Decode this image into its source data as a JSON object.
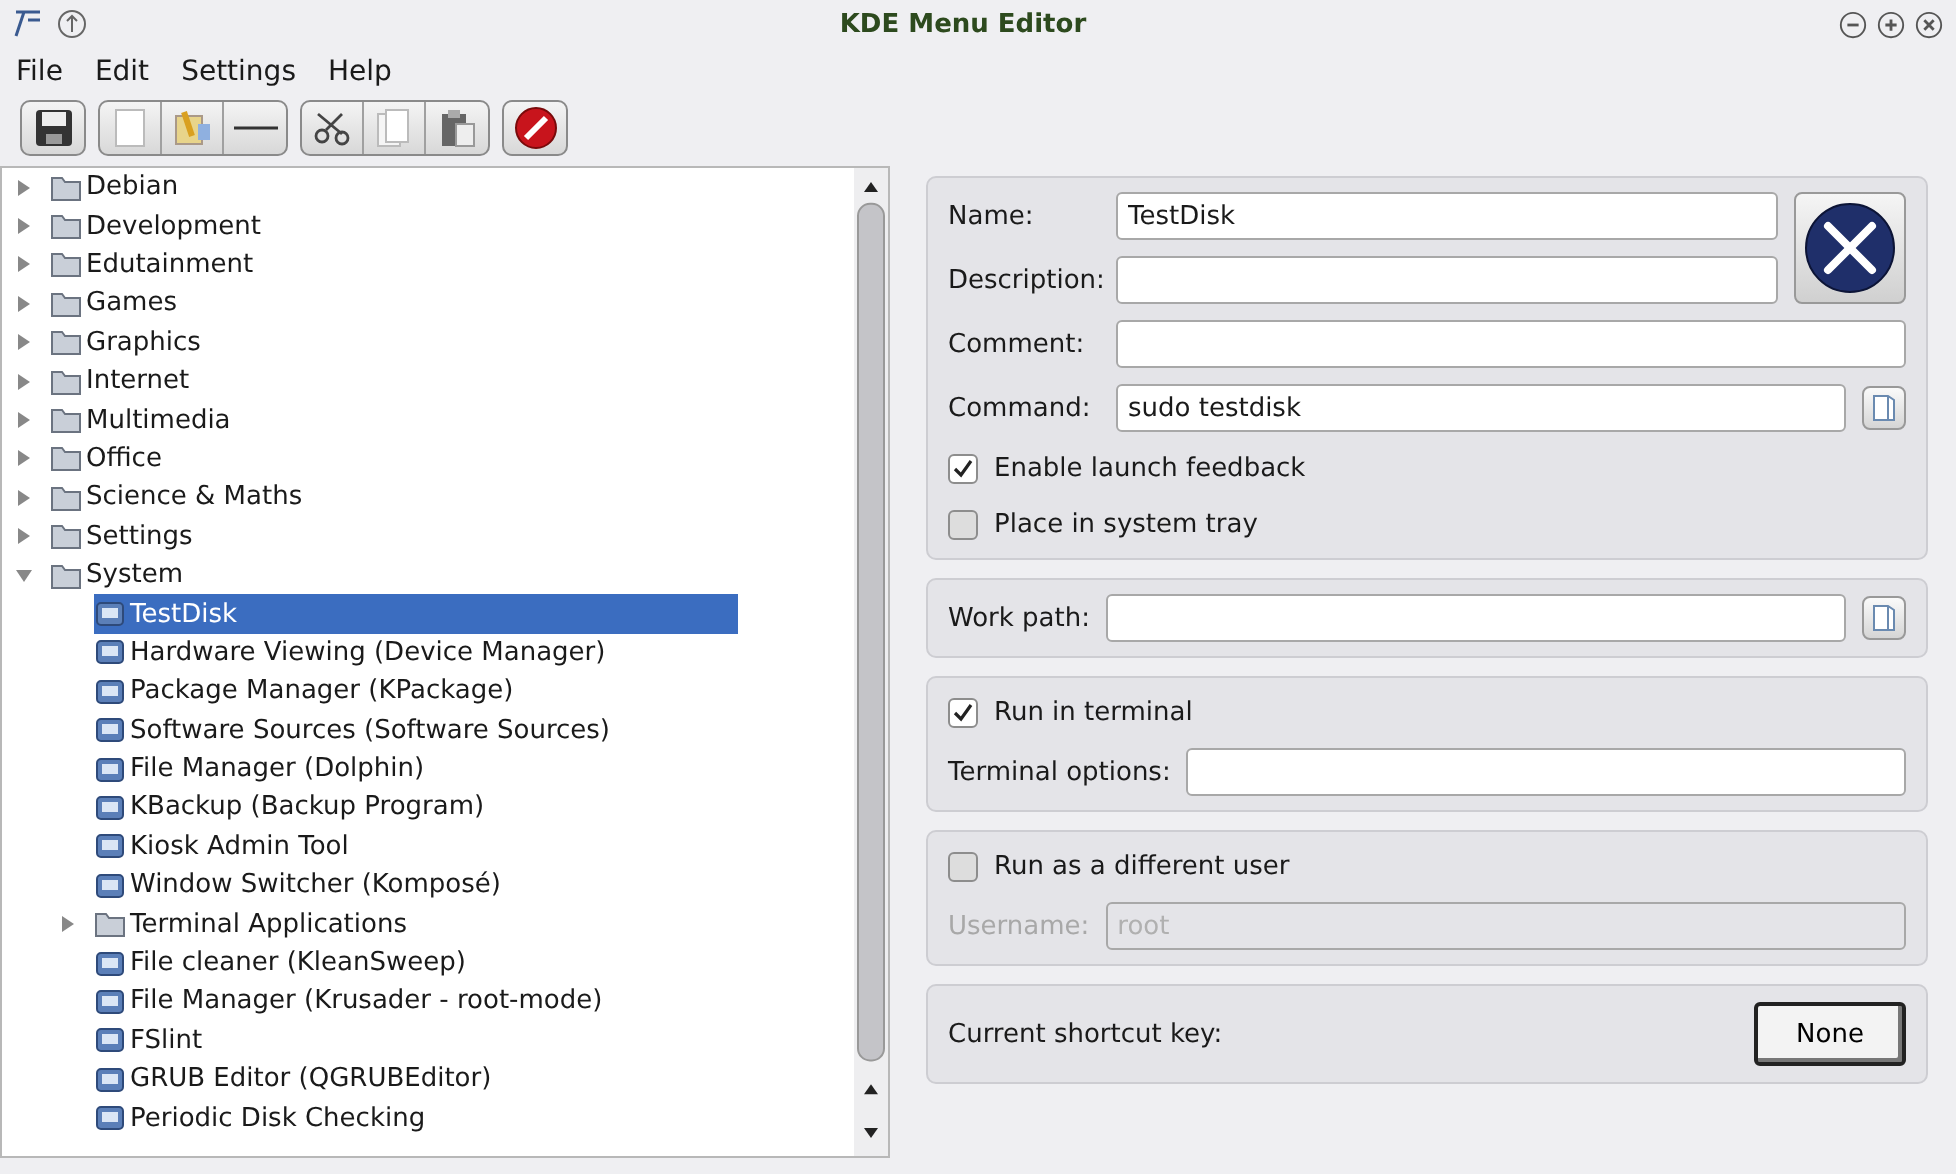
{
  "window": {
    "title": "KDE Menu Editor"
  },
  "menu": [
    "File",
    "Edit",
    "Settings",
    "Help"
  ],
  "tree": [
    {
      "label": "Debian",
      "kind": "folder",
      "expanded": false,
      "selected": false
    },
    {
      "label": "Development",
      "kind": "folder",
      "expanded": false,
      "selected": false
    },
    {
      "label": "Edutainment",
      "kind": "folder",
      "expanded": false,
      "selected": false
    },
    {
      "label": "Games",
      "kind": "folder",
      "expanded": false,
      "selected": false
    },
    {
      "label": "Graphics",
      "kind": "folder",
      "expanded": false,
      "selected": false
    },
    {
      "label": "Internet",
      "kind": "folder",
      "expanded": false,
      "selected": false
    },
    {
      "label": "Multimedia",
      "kind": "folder",
      "expanded": false,
      "selected": false
    },
    {
      "label": "Office",
      "kind": "folder",
      "expanded": false,
      "selected": false
    },
    {
      "label": "Science & Maths",
      "kind": "folder",
      "expanded": false,
      "selected": false
    },
    {
      "label": "Settings",
      "kind": "folder",
      "expanded": false,
      "selected": false
    },
    {
      "label": "System",
      "kind": "folder",
      "expanded": true,
      "selected": false,
      "children": [
        {
          "label": "TestDisk",
          "kind": "app",
          "selected": true
        },
        {
          "label": "Hardware Viewing (Device Manager)",
          "kind": "app",
          "selected": false
        },
        {
          "label": "Package Manager (KPackage)",
          "kind": "app",
          "selected": false
        },
        {
          "label": "Software Sources (Software Sources)",
          "kind": "app",
          "selected": false
        },
        {
          "label": "File Manager (Dolphin)",
          "kind": "app",
          "selected": false
        },
        {
          "label": "KBackup (Backup Program)",
          "kind": "app",
          "selected": false
        },
        {
          "label": "Kiosk Admin Tool",
          "kind": "app",
          "selected": false
        },
        {
          "label": "Window Switcher (Komposé)",
          "kind": "app",
          "selected": false
        },
        {
          "label": "Terminal Applications",
          "kind": "folder",
          "expanded": false,
          "selected": false
        },
        {
          "label": "File cleaner (KleanSweep)",
          "kind": "app",
          "selected": false
        },
        {
          "label": "File Manager (Krusader - root-mode)",
          "kind": "app",
          "selected": false
        },
        {
          "label": "FSlint",
          "kind": "app",
          "selected": false
        },
        {
          "label": "GRUB Editor (QGRUBEditor)",
          "kind": "app",
          "selected": false
        },
        {
          "label": "Periodic Disk Checking",
          "kind": "app",
          "selected": false
        }
      ]
    }
  ],
  "general": {
    "name_label": "Name:",
    "name": "TestDisk",
    "description_label": "Description:",
    "comment_label": "Comment:",
    "command_label": "Command:",
    "command": "sudo testdisk",
    "checks": [
      {
        "label": "Enable launch feedback",
        "checked": true
      },
      {
        "label": "Place in system tray",
        "checked": false
      }
    ]
  },
  "work_path": {
    "label": "Work path:"
  },
  "terminal": {
    "label": "Run in terminal",
    "checked": true,
    "options_label": "Terminal options:"
  },
  "user": {
    "label": "Run as a different user",
    "checked": false,
    "username_label": "Username:",
    "username": "root",
    "disabled": true
  },
  "shortcut": {
    "label": "Current shortcut key:",
    "value": "None"
  }
}
